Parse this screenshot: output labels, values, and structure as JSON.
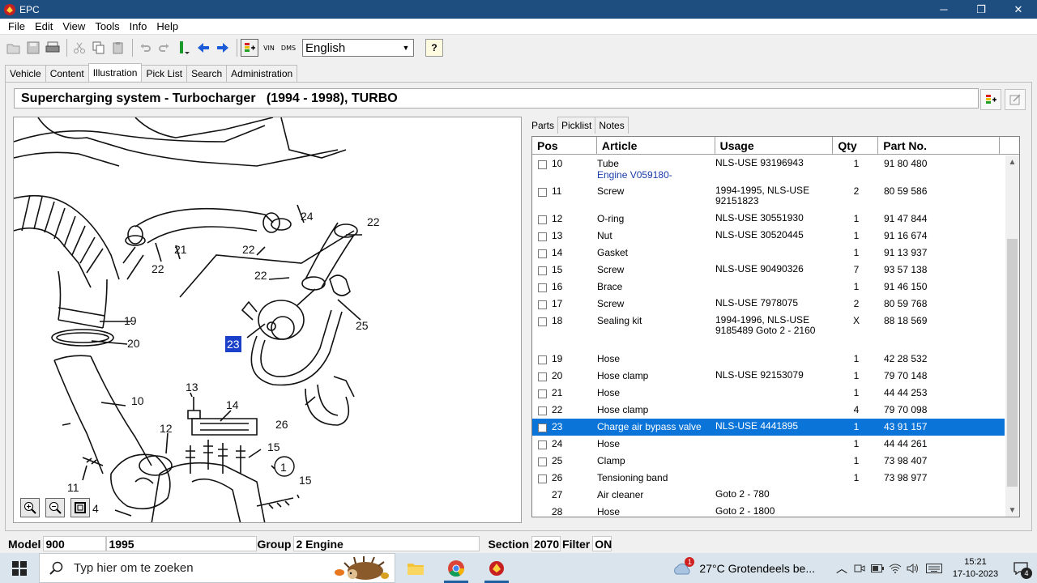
{
  "window": {
    "title": "EPC",
    "controls": {
      "minimize": "─",
      "maximize": "❐",
      "close": "✕"
    }
  },
  "menu": [
    "File",
    "Edit",
    "View",
    "Tools",
    "Info",
    "Help"
  ],
  "toolbar": {
    "language": "English",
    "vin_label": "VIN",
    "dms_label": "DMS",
    "help_label": "?"
  },
  "tabs": [
    "Vehicle",
    "Content",
    "Illustration",
    "Pick List",
    "Search",
    "Administration"
  ],
  "active_tab": "Illustration",
  "header_title": "Supercharging system - Turbocharger   (1994 - 1998), TURBO",
  "illustration": {
    "highlight_label": "23",
    "callouts": [
      "24",
      "22",
      "21",
      "22",
      "22",
      "22",
      "19",
      "20",
      "25",
      "23",
      "13",
      "14",
      "10",
      "12",
      "15",
      "1",
      "26",
      "11",
      "15",
      "4"
    ]
  },
  "sub_tabs": [
    "Parts",
    "Picklist",
    "Notes"
  ],
  "parts": {
    "columns": [
      "Pos",
      "Article",
      "Usage",
      "Qty",
      "Part No."
    ],
    "rows": [
      {
        "pos": "10",
        "article": "Tube",
        "article_sub": "Engine V059180-",
        "usage": "NLS-USE 93196943",
        "qty": "1",
        "part_no": "91 80 480",
        "checkbox": true
      },
      {
        "pos": "11",
        "article": "Screw",
        "article_sub": "",
        "usage": "1994-1995, NLS-USE 92151823",
        "qty": "2",
        "part_no": "80 59 586",
        "checkbox": true
      },
      {
        "pos": "12",
        "article": "O-ring",
        "article_sub": "",
        "usage": "NLS-USE 30551930",
        "qty": "1",
        "part_no": "91 47 844",
        "checkbox": true
      },
      {
        "pos": "13",
        "article": "Nut",
        "article_sub": "",
        "usage": "NLS-USE 30520445",
        "qty": "1",
        "part_no": "91 16 674",
        "checkbox": true
      },
      {
        "pos": "14",
        "article": "Gasket",
        "article_sub": "",
        "usage": "",
        "qty": "1",
        "part_no": "91 13 937",
        "checkbox": true
      },
      {
        "pos": "15",
        "article": "Screw",
        "article_sub": "",
        "usage": "NLS-USE 90490326",
        "qty": "7",
        "part_no": "93 57 138",
        "checkbox": true
      },
      {
        "pos": "16",
        "article": "Brace",
        "article_sub": "",
        "usage": "",
        "qty": "1",
        "part_no": "91 46 150",
        "checkbox": true
      },
      {
        "pos": "17",
        "article": "Screw",
        "article_sub": "",
        "usage": "NLS-USE 7978075",
        "qty": "2",
        "part_no": "80 59 768",
        "checkbox": true
      },
      {
        "pos": "18",
        "article": "Sealing kit",
        "article_sub": "",
        "usage": "1994-1996, NLS-USE 9185489 Goto 2 - 2160",
        "qty": "X",
        "part_no": "88 18 569",
        "checkbox": true
      },
      {
        "pos": "19",
        "article": "Hose",
        "article_sub": "",
        "usage": "",
        "qty": "1",
        "part_no": "42 28 532",
        "checkbox": true
      },
      {
        "pos": "20",
        "article": "Hose clamp",
        "article_sub": "",
        "usage": "NLS-USE 92153079",
        "qty": "1",
        "part_no": "79 70 148",
        "checkbox": true
      },
      {
        "pos": "21",
        "article": "Hose",
        "article_sub": "",
        "usage": "",
        "qty": "1",
        "part_no": "44 44 253",
        "checkbox": true
      },
      {
        "pos": "22",
        "article": "Hose clamp",
        "article_sub": "",
        "usage": "",
        "qty": "4",
        "part_no": "79 70 098",
        "checkbox": true
      },
      {
        "pos": "23",
        "article": "Charge air bypass valve",
        "article_sub": "",
        "usage": "NLS-USE 4441895",
        "qty": "1",
        "part_no": "43 91 157",
        "checkbox": true,
        "selected": true
      },
      {
        "pos": "24",
        "article": "Hose",
        "article_sub": "",
        "usage": "",
        "qty": "1",
        "part_no": "44 44 261",
        "checkbox": true
      },
      {
        "pos": "25",
        "article": "Clamp",
        "article_sub": "",
        "usage": "",
        "qty": "1",
        "part_no": "73 98 407",
        "checkbox": true
      },
      {
        "pos": "26",
        "article": "Tensioning band",
        "article_sub": "",
        "usage": "",
        "qty": "1",
        "part_no": "73 98 977",
        "checkbox": true
      },
      {
        "pos": "27",
        "article": "Air cleaner",
        "article_sub": "",
        "usage": "Goto 2 - 780",
        "qty": "",
        "part_no": "",
        "checkbox": false
      },
      {
        "pos": "28",
        "article": "Hose",
        "article_sub": "",
        "usage": "Goto 2 - 1800",
        "qty": "",
        "part_no": "",
        "checkbox": false
      }
    ]
  },
  "status": {
    "model_label": "Model",
    "model_value": "900",
    "year_value": "1995",
    "group_label": "Group",
    "group_value": "2 Engine",
    "section_label": "Section",
    "section_value": "2070",
    "filter_label": "Filter",
    "filter_value": "ON"
  },
  "taskbar": {
    "search_placeholder": "Typ hier om te zoeken",
    "weather_badge": "1",
    "weather_text": "27°C  Grotendeels be...",
    "time": "15:21",
    "date": "17-10-2023",
    "notification_count": "4"
  },
  "colors": {
    "titlebar": "#1e4d80",
    "selection": "#0a74d8",
    "highlight_callout": "#1a3fc9"
  }
}
